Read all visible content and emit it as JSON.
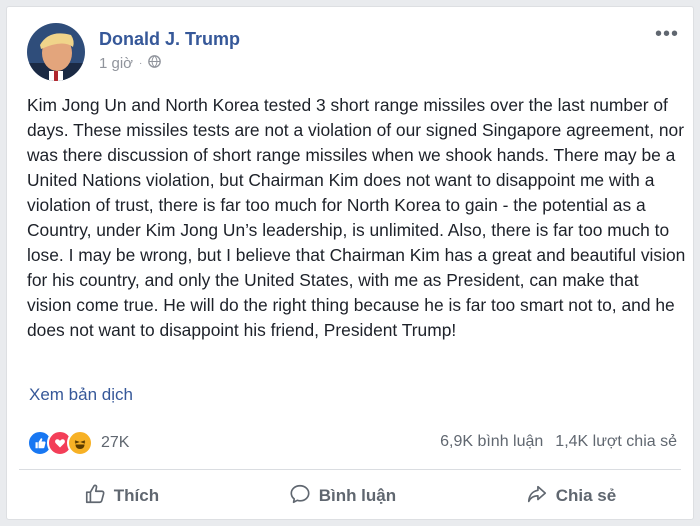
{
  "post": {
    "author": "Donald J. Trump",
    "time": "1 giờ",
    "privacy_icon": "globe-icon",
    "text": "Kim Jong Un and North Korea tested 3 short range missiles over the last number of days. These missiles tests are not a violation of our signed Singapore agreement, nor was there discussion of short range missiles when we shook hands. There may be a United Nations violation, but Chairman Kim does not want to disappoint me with a violation of trust, there is far too much for North Korea to gain - the potential as a Country, under Kim Jong Un’s leadership, is unlimited. Also, there is far too much to lose. I may be wrong, but I believe that Chairman Kim has a great and beautiful vision for his country, and only the United States, with me as President, can make that vision come true. He will do the right thing because he is far too smart not to, and he does not want to disappoint his friend, President Trump!",
    "translate_link": "Xem bản dịch"
  },
  "reactions": {
    "icons": [
      "like-icon",
      "love-icon",
      "haha-icon"
    ],
    "count": "27K",
    "comments": "6,9K bình luận",
    "shares": "1,4K lượt chia sẻ"
  },
  "actions": {
    "like": "Thích",
    "comment": "Bình luận",
    "share": "Chia sẻ"
  },
  "colors": {
    "author_link": "#365899",
    "meta": "#90949c",
    "like_blue": "#1877f2",
    "love_red": "#f33e58",
    "haha_yellow": "#f7b125"
  }
}
